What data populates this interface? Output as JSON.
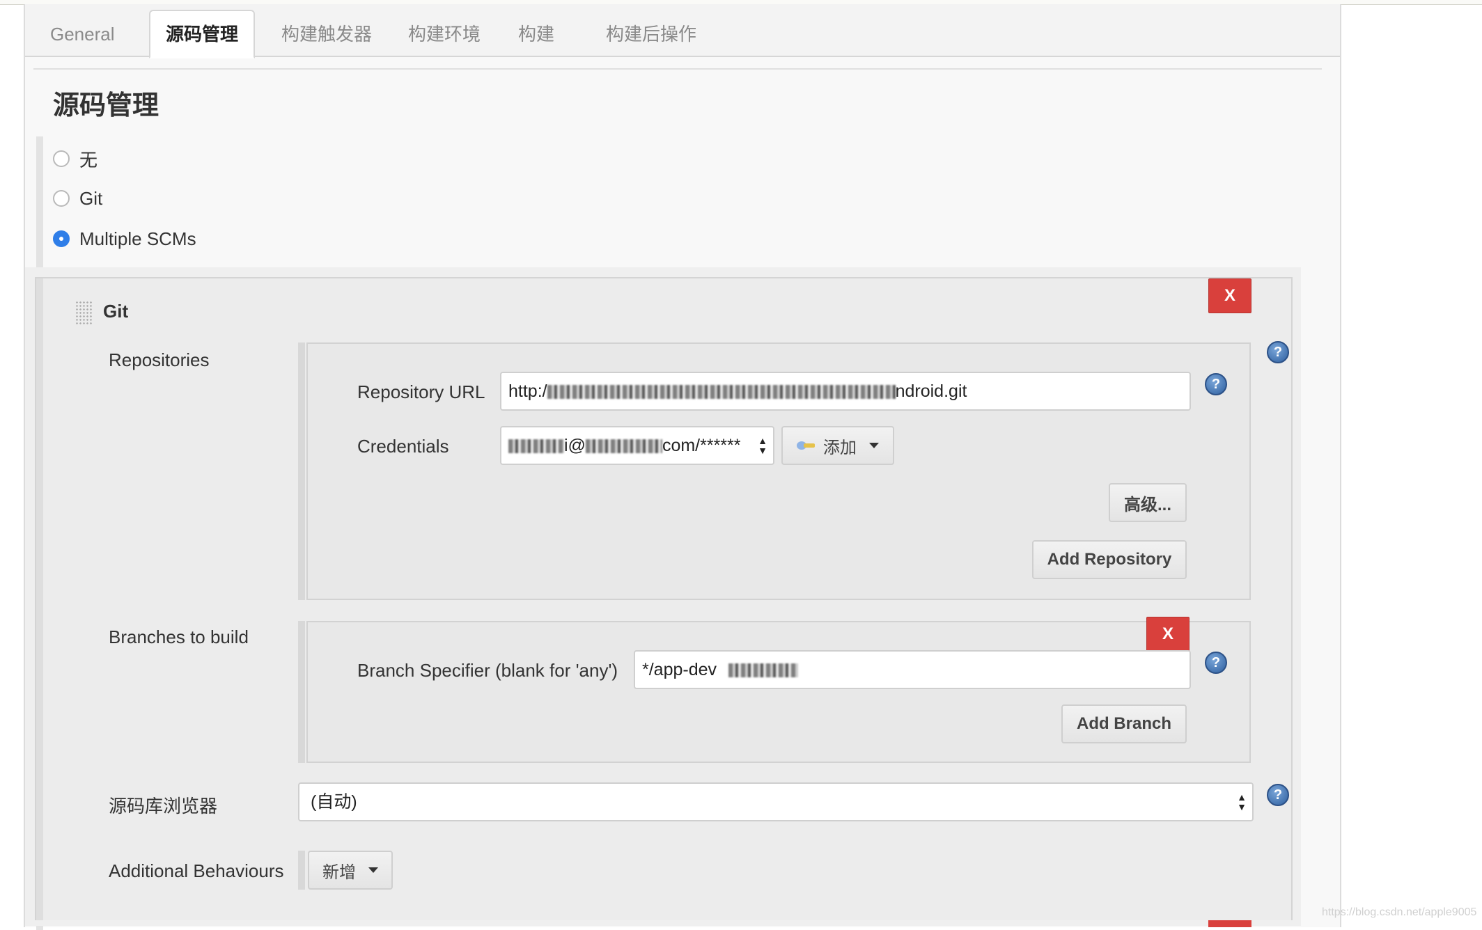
{
  "tabs": [
    {
      "label": "General",
      "active": false
    },
    {
      "label": "源码管理",
      "active": true
    },
    {
      "label": "构建触发器",
      "active": false
    },
    {
      "label": "构建环境",
      "active": false
    },
    {
      "label": "构建",
      "active": false
    },
    {
      "label": "构建后操作",
      "active": false
    }
  ],
  "section_title": "源码管理",
  "scm_options": [
    {
      "label": "无",
      "checked": false
    },
    {
      "label": "Git",
      "checked": false
    },
    {
      "label": "Multiple SCMs",
      "checked": true
    }
  ],
  "git_block": {
    "title": "Git",
    "delete_label": "X",
    "repositories_label": "Repositories",
    "repository_url_label": "Repository URL",
    "repository_url_prefix": "http:/",
    "repository_url_suffix": "ndroid.git",
    "credentials_label": "Credentials",
    "credentials_middle": "i@",
    "credentials_suffix": "com/******",
    "add_credential_label": "添加",
    "advanced_label": "高级...",
    "add_repository_label": "Add Repository",
    "branches_label": "Branches to build",
    "branch_delete_label": "X",
    "branch_specifier_label": "Branch Specifier (blank for 'any')",
    "branch_specifier_value": "*/app-dev",
    "add_branch_label": "Add Branch",
    "browser_label": "源码库浏览器",
    "browser_value": "(自动)",
    "behaviours_label": "Additional Behaviours",
    "behaviours_add_label": "新增"
  },
  "colors": {
    "delete_red": "#d9403c",
    "radio_blue": "#2f7ee8",
    "help_blue": "#2e5f9f"
  },
  "watermark": "https://blog.csdn.net/apple9005"
}
